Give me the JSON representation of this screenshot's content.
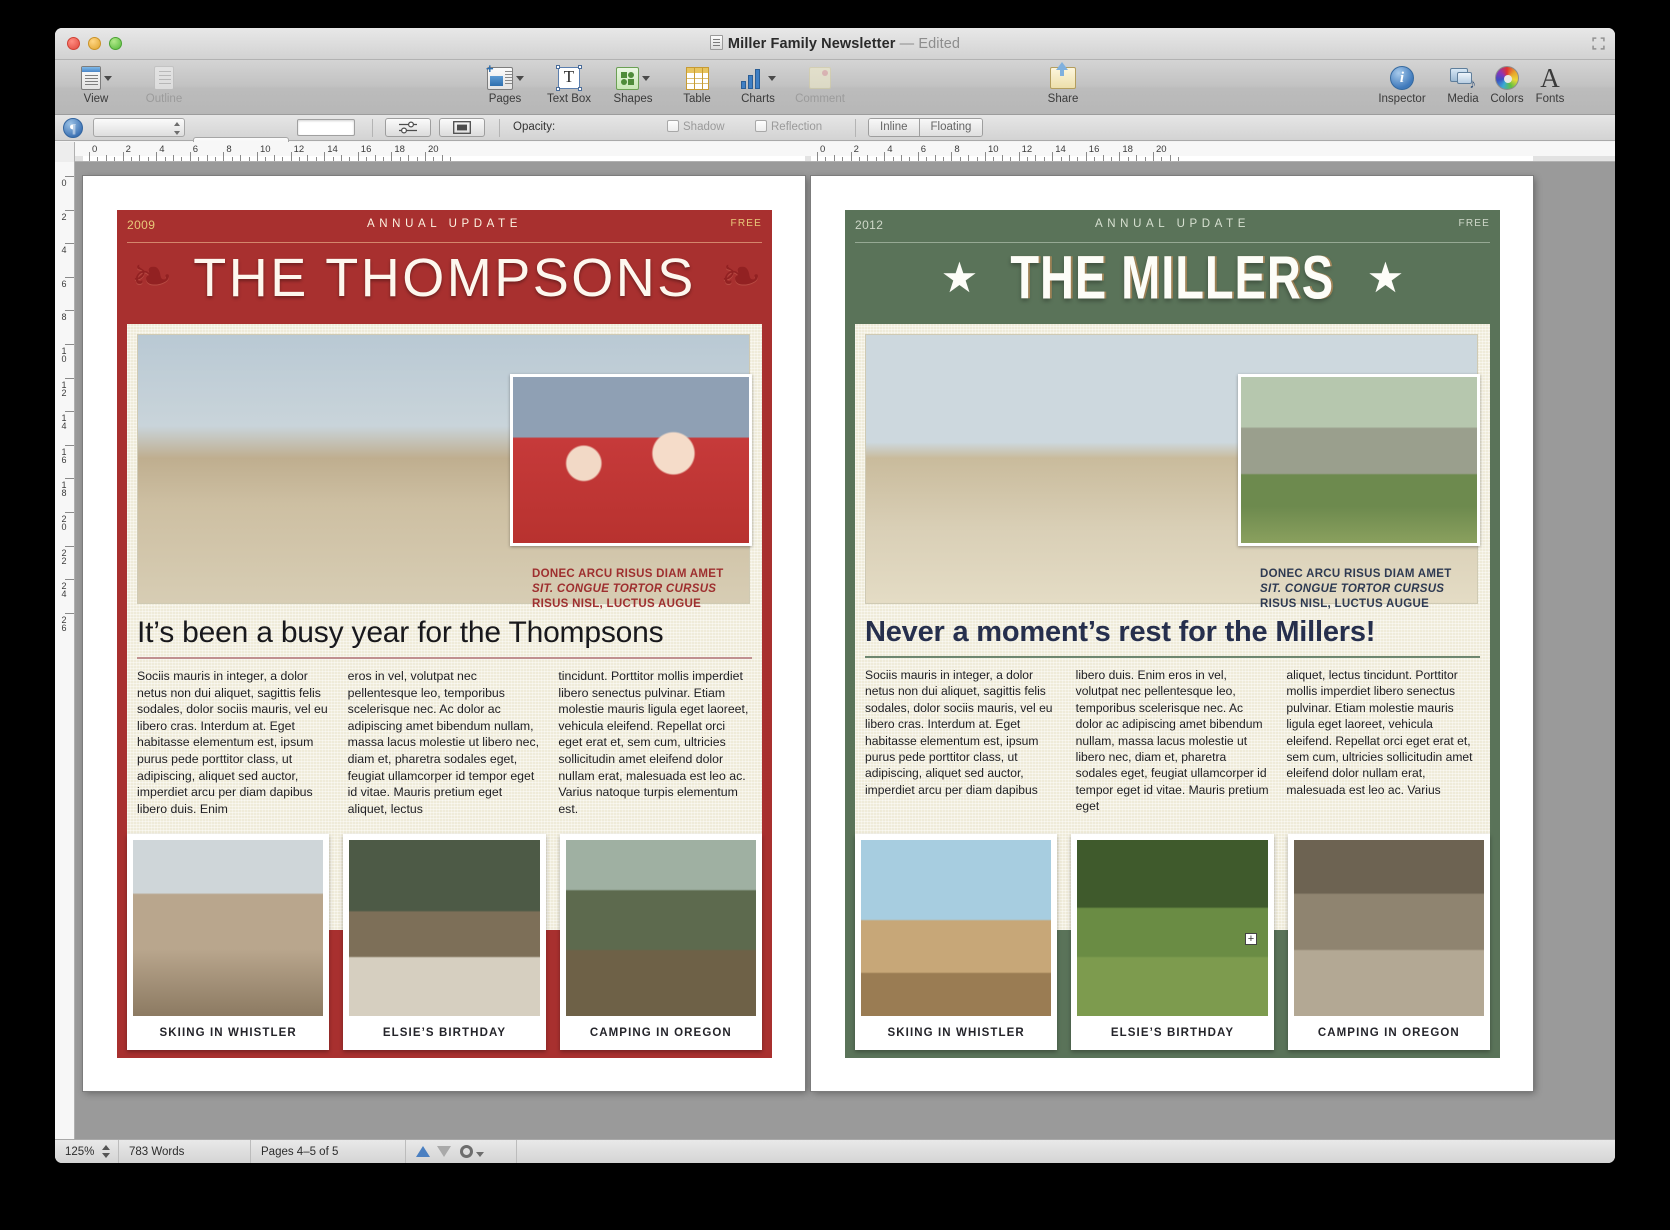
{
  "window": {
    "title": "Miller Family Newsletter",
    "edited_suffix": "— Edited"
  },
  "toolbar": {
    "items": [
      {
        "name": "view",
        "label": "View",
        "icon": "view-icon",
        "has_caret": true,
        "dim": false
      },
      {
        "name": "outline",
        "label": "Outline",
        "icon": "outline-icon",
        "has_caret": false,
        "dim": true
      },
      {
        "name": "pages",
        "label": "Pages",
        "icon": "pages-icon",
        "has_caret": true,
        "dim": false
      },
      {
        "name": "textbox",
        "label": "Text Box",
        "icon": "text-box-icon",
        "has_caret": false,
        "dim": false
      },
      {
        "name": "shapes",
        "label": "Shapes",
        "icon": "shapes-icon",
        "has_caret": true,
        "dim": false
      },
      {
        "name": "table",
        "label": "Table",
        "icon": "table-icon",
        "has_caret": false,
        "dim": false
      },
      {
        "name": "charts",
        "label": "Charts",
        "icon": "charts-icon",
        "has_caret": true,
        "dim": false
      },
      {
        "name": "comment",
        "label": "Comment",
        "icon": "comment-icon",
        "has_caret": false,
        "dim": true
      },
      {
        "name": "share",
        "label": "Share",
        "icon": "share-icon",
        "has_caret": false,
        "dim": false
      },
      {
        "name": "inspector",
        "label": "Inspector",
        "icon": "inspector-icon",
        "has_caret": false,
        "dim": false
      },
      {
        "name": "media",
        "label": "Media",
        "icon": "media-icon",
        "has_caret": false,
        "dim": false
      },
      {
        "name": "colors",
        "label": "Colors",
        "icon": "colors-icon",
        "has_caret": false,
        "dim": false
      },
      {
        "name": "fonts",
        "label": "Fonts",
        "icon": "fonts-icon",
        "has_caret": false,
        "dim": false
      }
    ]
  },
  "formatbar": {
    "pilcrow_glyph": "¶",
    "stroke_width_value": "",
    "stroke_style_value": "",
    "color_well_value": "",
    "opacity_label": "Opacity:",
    "opacity_value": "",
    "shadow_label": "Shadow",
    "shadow_checked": false,
    "reflection_label": "Reflection",
    "reflection_checked": false,
    "wrap_inline_label": "Inline",
    "wrap_floating_label": "Floating",
    "wrap_selected": "Inline",
    "wrap_stepper_value": ""
  },
  "rulers": {
    "h_numbers": [
      "0",
      "2",
      "4",
      "6",
      "8",
      "10",
      "12",
      "14",
      "16",
      "18",
      "20"
    ],
    "v_numbers": [
      "0",
      "2",
      "4",
      "6",
      "8",
      "10",
      "12",
      "14",
      "16",
      "18",
      "20",
      "22",
      "24",
      "26"
    ],
    "unit": "inches"
  },
  "statusbar": {
    "zoom": "125%",
    "word_count": "783 Words",
    "page_range": "Pages 4–5 of 5",
    "prev_page_icon": "triangle-up-icon",
    "next_page_icon": "triangle-down-icon",
    "settings_icon": "gear-icon"
  },
  "pages": [
    {
      "id": "page-left",
      "theme": "red",
      "accent_color": "#a8302f",
      "year": "2009",
      "kicker": "ANNUAL UPDATE",
      "price": "FREE",
      "masthead": "THE THOMPSONS",
      "ornament_left": "fleur-de-lis-icon",
      "ornament_right": "fleur-de-lis-icon",
      "main_photo_name": "family-on-beach-photo",
      "inset_photo_name": "kids-with-paper-crowns-photo",
      "photo_caption_line1": "DONEC ARCU RISUS DIAM AMET",
      "photo_caption_line2": "SIT. CONGUE TORTOR CURSUS",
      "photo_caption_line3": "RISUS NISL, LUCTUS AUGUE",
      "headline": "It’s been a busy year for the Thompsons",
      "columns": [
        "Sociis mauris in integer, a dolor netus non dui aliquet, sagittis felis sodales, dolor sociis mauris, vel eu libero cras. Interdum at. Eget habitasse elementum est, ipsum purus pede porttitor class, ut adipiscing, aliquet sed auctor, imperdiet arcu per diam dapibus libero duis. Enim",
        "eros in vel, volutpat nec pellentesque leo, temporibus scelerisque nec. Ac dolor ac adipiscing amet bibendum nullam, massa lacus molestie ut libero nec, diam et, pharetra sodales eget, feugiat ullamcorper id tempor eget id vitae. Mauris pretium eget aliquet, lectus",
        "tincidunt. Porttitor mollis imperdiet libero senectus pulvinar. Etiam molestie mauris ligula eget laoreet, vehicula eleifend. Repellat orci eget erat et, sem cum, ultricies sollicitudin amet eleifend dolor nullam erat, malesuada est leo ac. Varius natoque turpis elementum est."
      ],
      "polaroids": [
        {
          "caption": "SKIING IN WHISTLER",
          "photo_name": "mother-and-son-photo"
        },
        {
          "caption": "ELSIE’S BIRTHDAY",
          "photo_name": "birthday-cake-photo"
        },
        {
          "caption": "CAMPING IN OREGON",
          "photo_name": "campfire-photo"
        }
      ]
    },
    {
      "id": "page-right",
      "theme": "green",
      "accent_color": "#5a7359",
      "year": "2012",
      "kicker": "ANNUAL UPDATE",
      "price": "FREE",
      "masthead": "THE MILLERS",
      "ornament_left": "star-icon",
      "ornament_right": "star-icon",
      "main_photo_name": "family-walking-on-beach-photo",
      "inset_photo_name": "stone-cottage-photo",
      "photo_caption_line1": "DONEC ARCU RISUS DIAM AMET",
      "photo_caption_line2": "SIT. CONGUE TORTOR CURSUS",
      "photo_caption_line3": "RISUS NISL, LUCTUS AUGUE",
      "headline": "Never a moment’s rest for the Millers!",
      "columns": [
        "Sociis mauris in integer, a dolor netus non dui aliquet, sagittis felis sodales, dolor sociis mauris, vel eu libero cras. Interdum at. Eget habitasse elementum est, ipsum purus pede porttitor class, ut adipiscing, aliquet sed auctor, imperdiet arcu per diam dapibus",
        "libero duis. Enim eros in vel, volutpat nec pellentesque leo, temporibus scelerisque nec. Ac dolor ac adipiscing amet bibendum nullam, massa lacus molestie ut libero nec, diam et, pharetra sodales eget, feugiat ullamcorper id tempor eget id vitae. Mauris pretium eget",
        "aliquet, lectus tincidunt. Porttitor mollis imperdiet libero senectus pulvinar. Etiam molestie mauris ligula eget laoreet, vehicula eleifend. Repellat orci eget erat et, sem cum, ultricies sollicitudin amet eleifend dolor nullam erat, malesuada est leo ac. Varius"
      ],
      "polaroids": [
        {
          "caption": "SKIING IN WHISTLER",
          "photo_name": "playground-slide-photo"
        },
        {
          "caption": "ELSIE’S BIRTHDAY",
          "photo_name": "kids-running-photo"
        },
        {
          "caption": "CAMPING IN OREGON",
          "photo_name": "kids-splashing-photo"
        }
      ]
    }
  ]
}
